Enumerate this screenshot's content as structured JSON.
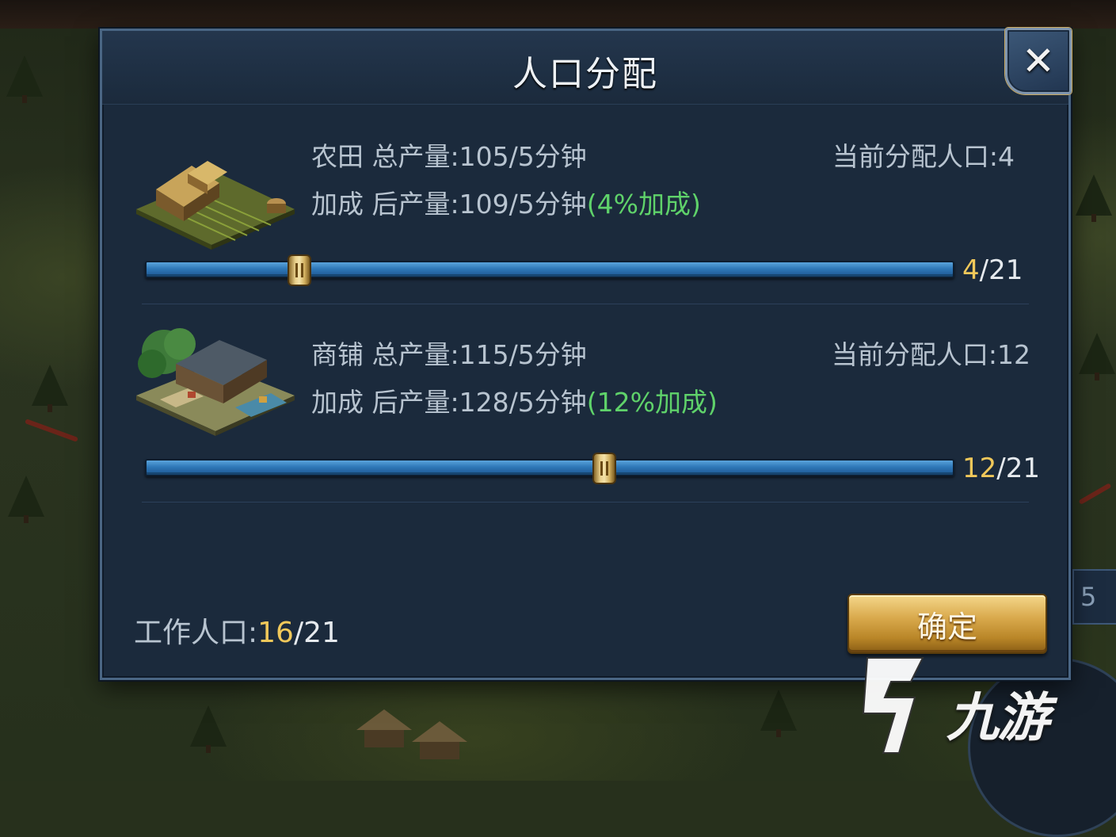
{
  "dialog": {
    "title": "人口分配",
    "close_label": "✕"
  },
  "buildings": [
    {
      "name": "农田",
      "total_output": "总产量:105/5分钟",
      "bonus_output": "后产量:109/5分钟",
      "bonus_prefix": "加成",
      "bonus_percent": "(4%加成)",
      "assigned": "当前分配人口:4",
      "slider_current": "4",
      "slider_max": "/21",
      "slider_fraction": 0.19
    },
    {
      "name": "商铺",
      "total_output": "总产量:115/5分钟",
      "bonus_output": "后产量:128/5分钟",
      "bonus_prefix": "加成",
      "bonus_percent": "(12%加成)",
      "assigned": "当前分配人口:12",
      "slider_current": "12",
      "slider_max": "/21",
      "slider_fraction": 0.568
    }
  ],
  "footer": {
    "work_label": "工作人口:",
    "work_current": "16",
    "work_total": "/21",
    "confirm_label": "确定"
  },
  "edge": {
    "badge_text": "5"
  },
  "watermark": {
    "text": "九游"
  },
  "colors": {
    "bonus_green": "#5fd26a",
    "value_gold": "#f0c85a",
    "track_blue": "#2f78b8"
  }
}
